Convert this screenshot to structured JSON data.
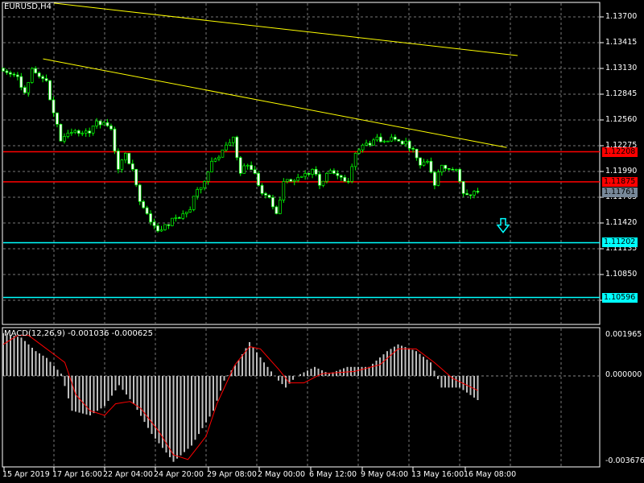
{
  "header": {
    "title": "EURUSD,H4"
  },
  "macd": {
    "label": "MACD(12,26,9) -0.001036 -0.000625",
    "axis_top": "0.001965",
    "axis_zero": "0.000000",
    "axis_bottom": "-0.003676",
    "range": [
      -0.003676,
      0.001965
    ],
    "histogram": [
      [
        0,
        0.0019
      ],
      [
        5,
        0.0017
      ],
      [
        9,
        0.0011
      ],
      [
        12,
        0.0008
      ],
      [
        16,
        0.0001
      ],
      [
        19,
        -0.0015
      ],
      [
        24,
        -0.0017
      ],
      [
        28,
        -0.0013
      ],
      [
        32,
        -0.0004
      ],
      [
        36,
        -0.0012
      ],
      [
        41,
        -0.0025
      ],
      [
        47,
        -0.0037
      ],
      [
        52,
        -0.003
      ],
      [
        58,
        -0.0015
      ],
      [
        61,
        -0.0002
      ],
      [
        65,
        0.0007
      ],
      [
        68,
        0.0015
      ],
      [
        72,
        0.0006
      ],
      [
        76,
        -0.0002
      ],
      [
        78,
        -0.0005
      ],
      [
        81,
        0.0
      ],
      [
        86,
        0.0004
      ],
      [
        90,
        0.0001
      ],
      [
        95,
        0.0004
      ],
      [
        101,
        0.0004
      ],
      [
        106,
        0.0011
      ],
      [
        109,
        0.0014
      ],
      [
        114,
        0.0011
      ],
      [
        118,
        0.0006
      ],
      [
        121,
        -0.0005
      ],
      [
        126,
        -0.0005
      ],
      [
        131,
        -0.00104
      ]
    ],
    "signal": [
      [
        0,
        0.0014
      ],
      [
        4,
        0.0018
      ],
      [
        7,
        0.0018
      ],
      [
        12,
        0.0012
      ],
      [
        17,
        0.0006
      ],
      [
        20,
        -0.0008
      ],
      [
        24,
        -0.0015
      ],
      [
        28,
        -0.0017
      ],
      [
        31,
        -0.0012
      ],
      [
        35,
        -0.0011
      ],
      [
        38,
        -0.0014
      ],
      [
        43,
        -0.0024
      ],
      [
        47,
        -0.0034
      ],
      [
        51,
        -0.0036
      ],
      [
        56,
        -0.0026
      ],
      [
        59,
        -0.0012
      ],
      [
        64,
        0.0005
      ],
      [
        68,
        0.0013
      ],
      [
        71,
        0.0012
      ],
      [
        76,
        0.0003
      ],
      [
        79,
        -0.0003
      ],
      [
        83,
        -0.0003
      ],
      [
        88,
        0.0001
      ],
      [
        97,
        0.0002
      ],
      [
        104,
        0.0005
      ],
      [
        109,
        0.0012
      ],
      [
        114,
        0.0012
      ],
      [
        119,
        0.0006
      ],
      [
        124,
        -0.0001
      ],
      [
        131,
        -0.000625
      ]
    ],
    "hist_color": "#c0c0c0",
    "signal_color": "#ff0000"
  },
  "price_axis": {
    "ticks": [
      "1.13700",
      "1.13415",
      "1.13130",
      "1.12845",
      "1.12560",
      "1.12275",
      "1.11990",
      "1.11705",
      "1.11420",
      "1.11135",
      "1.10850",
      "1.10565"
    ],
    "top": 1.137,
    "step": 0.00285
  },
  "levels": [
    {
      "price": 1.12208,
      "label": "1.12208",
      "color": "#ff0000"
    },
    {
      "price": 1.11875,
      "label": "1.11875",
      "color": "#ff0000"
    },
    {
      "price": 1.11202,
      "label": "1.11202",
      "color": "#00ffff"
    },
    {
      "price": 1.10596,
      "label": "1.10596",
      "color": "#00ffff"
    }
  ],
  "current_price": {
    "label": "1.11761",
    "color": "#778899"
  },
  "trendlines": [
    {
      "from": [
        14,
        1.13852
      ],
      "to": [
        142,
        1.13272
      ],
      "color": "#ffff00"
    },
    {
      "from": [
        11,
        1.13236
      ],
      "to": [
        139,
        1.12255
      ],
      "color": "#ffff00"
    }
  ],
  "signal_arrow": {
    "icon": "arrow-down-icon",
    "bar": 138,
    "price": 1.1137,
    "color": "#00ffff"
  },
  "time_axis": [
    "15 Apr 2019",
    "17 Apr 16:00",
    "22 Apr 04:00",
    "24 Apr 20:00",
    "29 Apr 08:00",
    "2 May 00:00",
    "6 May 12:00",
    "9 May 04:00",
    "13 May 16:00",
    "16 May 08:00"
  ],
  "closes": [
    1.13102,
    1.13067,
    1.1304,
    1.12861,
    1.13129,
    1.1304,
    1.12995,
    1.12638,
    1.12326,
    1.12415,
    1.12442,
    1.12415,
    1.12415,
    1.12549,
    1.12531,
    1.1246,
    1.12014,
    1.12192,
    1.12014,
    1.11657,
    1.11523,
    1.1139,
    1.11345,
    1.1139,
    1.11479,
    1.11523,
    1.11568,
    1.11791,
    1.1188,
    1.12103,
    1.12148,
    1.12282,
    1.12371,
    1.11969,
    1.12059,
    1.11969,
    1.11746,
    1.11702,
    1.11523,
    1.1188,
    1.1188,
    1.11925,
    1.11969,
    1.12014,
    1.11836,
    1.11969,
    1.11969,
    1.11925,
    1.1188,
    1.12192,
    1.12282,
    1.12282,
    1.12371,
    1.12326,
    1.12371,
    1.12326,
    1.12326,
    1.12237,
    1.12059,
    1.12103,
    1.11836,
    1.12059,
    1.12014,
    1.12014,
    1.11746,
    1.11729,
    1.11761
  ]
}
